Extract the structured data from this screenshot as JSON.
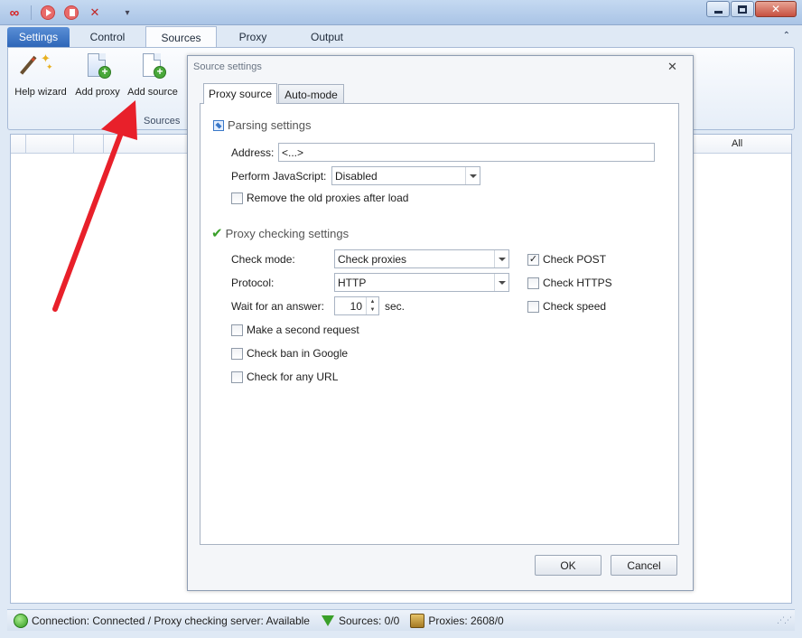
{
  "quick_access": {
    "more_label": "▾"
  },
  "ribbon_tabs": [
    "Settings",
    "Control",
    "Sources",
    "Proxy",
    "Output"
  ],
  "ribbon": {
    "buttons": [
      {
        "label": "Help wizard",
        "icon": "wand-icon"
      },
      {
        "label": "Add proxy",
        "icon": "add-proxy-icon"
      },
      {
        "label": "Add source",
        "icon": "add-source-icon"
      }
    ],
    "group_label": "Sources",
    "collapse_glyph": "⌃"
  },
  "grid": {
    "all_label": "All"
  },
  "status": {
    "connection": "Connection: Connected / Proxy checking server: Available",
    "sources": "Sources: 0/0",
    "proxies": "Proxies: 2608/0"
  },
  "dialog": {
    "title": "Source settings",
    "close_glyph": "✕",
    "tabs": [
      "Proxy source",
      "Auto-mode"
    ],
    "parsing": {
      "header": "Parsing settings",
      "address_label": "Address:",
      "address_value": "<...>",
      "js_label": "Perform JavaScript:",
      "js_value": "Disabled",
      "remove_old_label": "Remove the old proxies after load",
      "remove_old_checked": false
    },
    "checking": {
      "header": "Proxy checking settings",
      "mode_label": "Check mode:",
      "mode_value": "Check proxies",
      "protocol_label": "Protocol:",
      "protocol_value": "HTTP",
      "wait_label": "Wait for an answer:",
      "wait_value": "10",
      "wait_unit": "sec.",
      "second_request_label": "Make a second request",
      "ban_google_label": "Check ban in Google",
      "any_url_label": "Check for any URL",
      "post_label": "Check POST",
      "post_checked": true,
      "https_label": "Check HTTPS",
      "speed_label": "Check speed"
    },
    "ok_label": "OK",
    "cancel_label": "Cancel"
  },
  "colors": {
    "accent": "#2e66b8",
    "annotation_arrow": "#e8202a"
  }
}
